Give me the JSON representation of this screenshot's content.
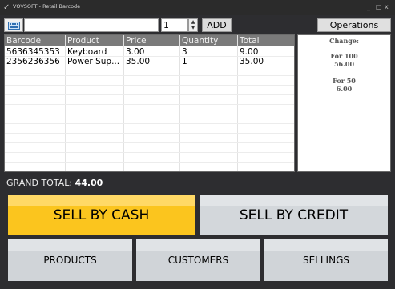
{
  "window": {
    "title": "VOVSOFT - Retail Barcode",
    "minimize": "_",
    "maximize": "□",
    "close": "x"
  },
  "toolbar": {
    "barcode_value": "",
    "quantity_value": "1",
    "add_label": "ADD",
    "operations_label": "Operations"
  },
  "table": {
    "columns": [
      "Barcode",
      "Product",
      "Price",
      "Quantity",
      "Total"
    ],
    "rows": [
      [
        "5636345353",
        "Keyboard",
        "3.00",
        "3",
        "9.00"
      ],
      [
        "2356236356",
        "Power Sup...",
        "35.00",
        "1",
        "35.00"
      ]
    ]
  },
  "change_panel": {
    "heading": "Change:",
    "entries": [
      {
        "label": "For 100",
        "value": "56.00"
      },
      {
        "label": "For 50",
        "value": "6.00"
      }
    ]
  },
  "grand_total": {
    "label": "GRAND TOTAL:",
    "value": "44.00"
  },
  "buttons": {
    "sell_cash": "SELL BY CASH",
    "sell_credit": "SELL BY CREDIT",
    "products": "PRODUCTS",
    "customers": "CUSTOMERS",
    "sellings": "SELLINGS"
  },
  "colors": {
    "accent_cash": "#fbc51e",
    "panel_dark": "#2d2d30",
    "header_gray": "#7a7a7a"
  }
}
